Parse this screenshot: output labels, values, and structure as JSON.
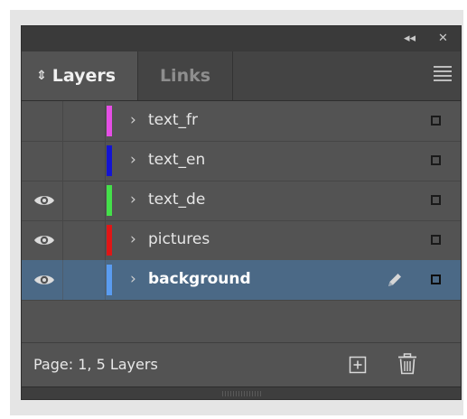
{
  "panel": {
    "controls": {
      "collapse_glyph": "◂◂",
      "close_glyph": "✕"
    },
    "tabs": [
      {
        "label": "Layers",
        "icon": "updown-arrows-icon",
        "icon_glyph": "⇕",
        "active": true
      },
      {
        "label": "Links",
        "active": false
      }
    ],
    "menu_icon": "hamburger-menu-icon"
  },
  "layers": [
    {
      "name": "text_fr",
      "visible": false,
      "color": "#e54ee5",
      "selected": false
    },
    {
      "name": "text_en",
      "visible": false,
      "color": "#1414d2",
      "selected": false
    },
    {
      "name": "text_de",
      "visible": true,
      "color": "#44e04a",
      "selected": false
    },
    {
      "name": "pictures",
      "visible": true,
      "color": "#e01616",
      "selected": false
    },
    {
      "name": "background",
      "visible": true,
      "color": "#5a9cf0",
      "selected": true
    }
  ],
  "row_chevron": "›",
  "footer": {
    "page_info": "Page: 1, 5 Layers",
    "new_layer_icon": "new-layer-icon",
    "delete_icon": "trash-icon"
  },
  "colors": {
    "panel_bg": "#535353",
    "selected_row": "#4b6986"
  }
}
